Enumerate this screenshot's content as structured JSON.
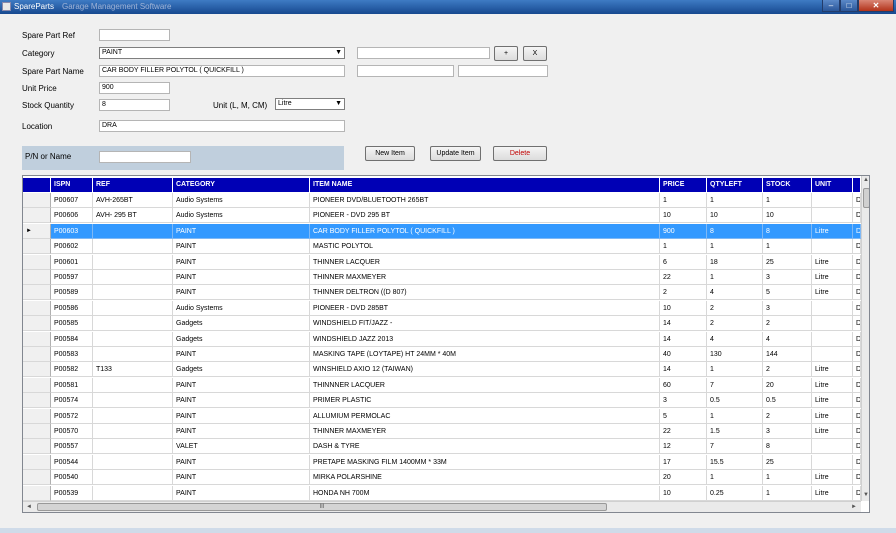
{
  "window": {
    "title": "SpareParts",
    "subtitle": "Garage Management Software",
    "min": "–",
    "max": "□",
    "close": "✕"
  },
  "form": {
    "spare_part_ref_label": "Spare Part Ref",
    "spare_part_ref_value": "",
    "category_label": "Category",
    "category_value": "PAINT",
    "add_label": "+",
    "remove_label": "X",
    "spare_part_name_label": "Spare Part Name",
    "spare_part_name_value": "CAR BODY FILLER POLYTOL ( QUICKFILL )",
    "unit_price_label": "Unit Price",
    "unit_price_value": "900",
    "stock_quantity_label": "Stock Quantity",
    "stock_quantity_value": "8",
    "unit_label": "Unit (L, M, CM)",
    "unit_value": "Litre",
    "location_label": "Location",
    "location_value": "DRA"
  },
  "search": {
    "label": "P/N or Name",
    "value": ""
  },
  "buttons": {
    "new_item": "New Item",
    "update_item": "Update Item",
    "delete": "Delete"
  },
  "grid": {
    "columns": [
      "ISPN",
      "REF",
      "CATEGORY",
      "ITEM NAME",
      "PRICE",
      "QTYLEFT",
      "STOCK",
      "UNIT",
      ""
    ],
    "selected_index": 2,
    "rows": [
      [
        "P00607",
        "AVH-265BT",
        "Audio Systems",
        "PIONEER DVD/BLUETOOTH 265BT",
        "1",
        "1",
        "1",
        "",
        "D"
      ],
      [
        "P00606",
        "AVH- 295 BT",
        "Audio Systems",
        "PIONEER - DVD 295 BT",
        "10",
        "10",
        "10",
        "",
        "D"
      ],
      [
        "P00603",
        "",
        "PAINT",
        "CAR BODY FILLER POLYTOL ( QUICKFILL )",
        "900",
        "8",
        "8",
        "Litre",
        "D"
      ],
      [
        "P00602",
        "",
        "PAINT",
        "MASTIC POLYTOL",
        "1",
        "1",
        "1",
        "",
        "D"
      ],
      [
        "P00601",
        "",
        "PAINT",
        "THINNER LACQUER",
        "6",
        "18",
        "25",
        "Litre",
        "D"
      ],
      [
        "P00597",
        "",
        "PAINT",
        "THINNER MAXMEYER",
        "22",
        "1",
        "3",
        "Litre",
        "D"
      ],
      [
        "P00589",
        "",
        "PAINT",
        "THINNER DELTRON ((D 807)",
        "2",
        "4",
        "5",
        "Litre",
        "D"
      ],
      [
        "P00586",
        "",
        "Audio Systems",
        "PIONEER - DVD 285BT",
        "10",
        "2",
        "3",
        "",
        "D"
      ],
      [
        "P00585",
        "",
        "Gadgets",
        "WINDSHIELD FIT/JAZZ  -",
        "14",
        "2",
        "2",
        "",
        "D"
      ],
      [
        "P00584",
        "",
        "Gadgets",
        "WINDSHIELD JAZZ 2013",
        "14",
        "4",
        "4",
        "",
        "D"
      ],
      [
        "P00583",
        "",
        "PAINT",
        "MASKING TAPE (LOYTAPE) HT 24MM * 40M",
        "40",
        "130",
        "144",
        "",
        "D"
      ],
      [
        "P00582",
        "T133",
        "Gadgets",
        "WINSHIELD AXIO 12 (TAIWAN)",
        "14",
        "1",
        "2",
        "Litre",
        "D"
      ],
      [
        "P00581",
        "",
        "PAINT",
        "THINNNER LACQUER",
        "60",
        "7",
        "20",
        "Litre",
        "D"
      ],
      [
        "P00574",
        "",
        "PAINT",
        "PRIMER PLASTIC",
        "3",
        "0.5",
        "0.5",
        "Litre",
        "D"
      ],
      [
        "P00572",
        "",
        "PAINT",
        "ALLUMIUM PERMOLAC",
        "5",
        "1",
        "2",
        "Litre",
        "D"
      ],
      [
        "P00570",
        "",
        "PAINT",
        "THINNER MAXMEYER",
        "22",
        "1.5",
        "3",
        "Litre",
        "D"
      ],
      [
        "P00557",
        "",
        "VALET",
        "DASH & TYRE",
        "12",
        "7",
        "8",
        "",
        "D"
      ],
      [
        "P00544",
        "",
        "PAINT",
        "PRETAPE MASKING FILM 1400MM * 33M",
        "17",
        "15.5",
        "25",
        "",
        "D"
      ],
      [
        "P00540",
        "",
        "PAINT",
        "MIRKA POLARSHINE",
        "20",
        "1",
        "1",
        "Litre",
        "D"
      ],
      [
        "P00539",
        "",
        "PAINT",
        "HONDA NH 700M",
        "10",
        "0.25",
        "1",
        "Litre",
        "D"
      ]
    ]
  },
  "scroll": {
    "up": "▲",
    "down": "▼",
    "left": "◄",
    "right": "►",
    "grip": "III"
  }
}
